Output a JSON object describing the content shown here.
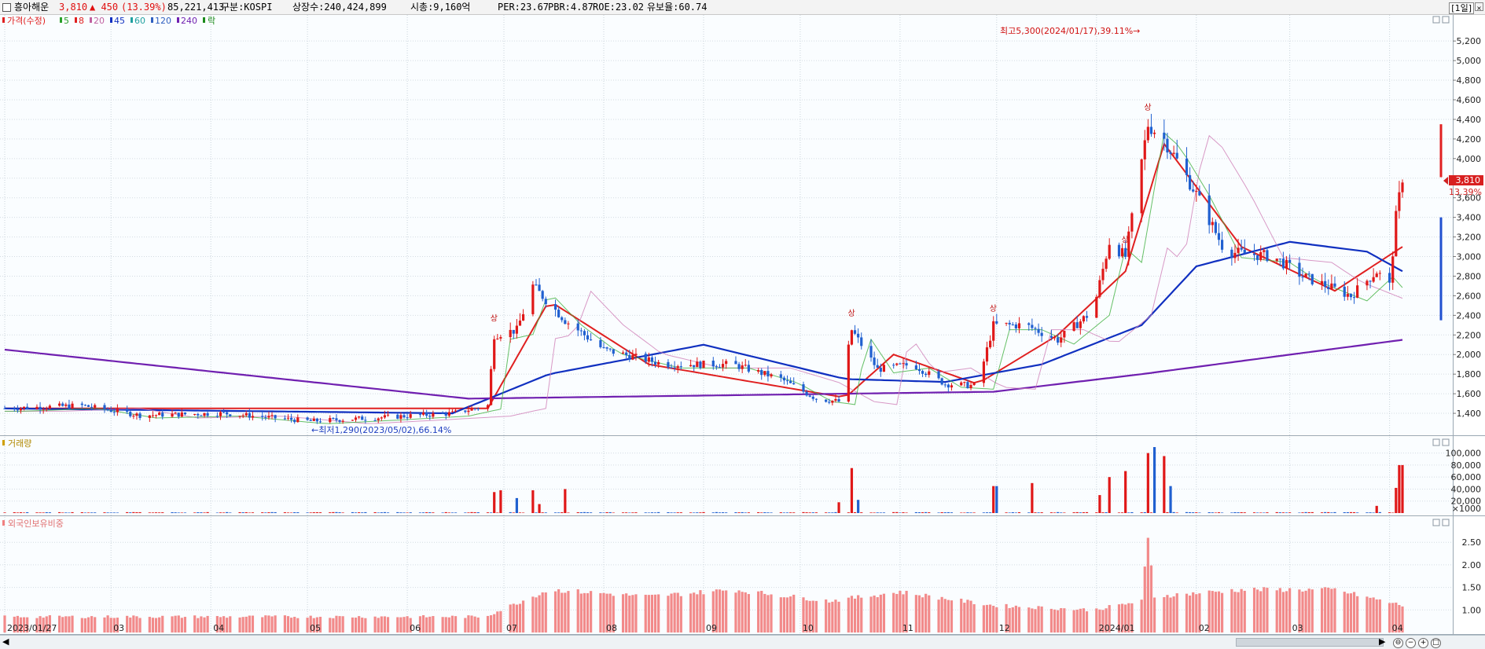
{
  "header": {
    "stock_name": "흥아해운",
    "price": "3,810",
    "change": "▲ 450",
    "change_pct": "(13.39%)",
    "volume": "85,221,413",
    "market": "구분:KOSPI",
    "shares": "상장수:240,424,899",
    "market_cap": "시총:9,160억",
    "per": "PER:23.67",
    "pbr": "PBR:4.87",
    "roe": "ROE:23.02",
    "float_ratio": "유보율:60.74",
    "period": "[1일]"
  },
  "legend": {
    "price_label": "가격(수정)",
    "ma_items": [
      {
        "label": "5",
        "color": "#2aa02a"
      },
      {
        "label": "8",
        "color": "#e02020"
      },
      {
        "label": "20",
        "color": "#c060a0"
      },
      {
        "label": "45",
        "color": "#1030c0"
      },
      {
        "label": "60",
        "color": "#20a0a0"
      },
      {
        "label": "120",
        "color": "#3060c0"
      },
      {
        "label": "240",
        "color": "#7020b0"
      }
    ],
    "limit_label": "락",
    "volume_label": "거래량",
    "foreign_label": "외국인보유비중"
  },
  "chart_data": [
    {
      "type": "candlestick",
      "title": "",
      "x_tick_labels": [
        "2023/01/27",
        "03",
        "04",
        "05",
        "06",
        "07",
        "08",
        "09",
        "10",
        "11",
        "12",
        "2024/01",
        "02",
        "03",
        "04"
      ],
      "y_tick_labels": [
        "1,400",
        "1,600",
        "1,800",
        "2,000",
        "2,200",
        "2,400",
        "2,600",
        "2,800",
        "3,000",
        "3,200",
        "3,400",
        "3,600",
        "3,800",
        "4,000",
        "4,200",
        "4,400",
        "4,600",
        "4,800",
        "5,000",
        "5,200"
      ],
      "ylim": [
        1200,
        5450
      ],
      "last_price_tag": "3,810",
      "last_pct_tag": "13.39%",
      "annotations": {
        "high": "최고5,300(2024/01/17),39.11%→",
        "low": "←최저1,290(2023/05/02),66.14%",
        "upper_limit_marker": "상"
      },
      "price_path": [
        [
          "2023-01-27",
          1450
        ],
        [
          "2023-02-20",
          1480
        ],
        [
          "2023-03-10",
          1380
        ],
        [
          "2023-04-05",
          1400
        ],
        [
          "2023-05-02",
          1320
        ],
        [
          "2023-05-25",
          1360
        ],
        [
          "2023-06-15",
          1400
        ],
        [
          "2023-06-26",
          1480
        ],
        [
          "2023-06-28",
          2200
        ],
        [
          "2023-07-05",
          2250
        ],
        [
          "2023-07-10",
          2700
        ],
        [
          "2023-07-20",
          2350
        ],
        [
          "2023-08-01",
          2050
        ],
        [
          "2023-08-20",
          1900
        ],
        [
          "2023-09-10",
          1900
        ],
        [
          "2023-09-25",
          1750
        ],
        [
          "2023-10-06",
          1550
        ],
        [
          "2023-10-13",
          1520
        ],
        [
          "2023-10-17",
          2250
        ],
        [
          "2023-10-25",
          1850
        ],
        [
          "2023-11-05",
          1900
        ],
        [
          "2023-11-15",
          1700
        ],
        [
          "2023-11-25",
          1680
        ],
        [
          "2023-11-30",
          2300
        ],
        [
          "2023-12-10",
          2300
        ],
        [
          "2023-12-20",
          2150
        ],
        [
          "2023-12-31",
          2450
        ],
        [
          "2024-01-05",
          3150
        ],
        [
          "2024-01-10",
          3000
        ],
        [
          "2024-01-17",
          4350
        ],
        [
          "2024-01-22",
          4200
        ],
        [
          "2024-01-31",
          3700
        ],
        [
          "2024-02-10",
          3050
        ],
        [
          "2024-02-25",
          3000
        ],
        [
          "2024-03-05",
          2800
        ],
        [
          "2024-03-20",
          2600
        ],
        [
          "2024-03-28",
          2850
        ],
        [
          "2024-04-01",
          2700
        ],
        [
          "2024-04-03",
          3400
        ],
        [
          "2024-04-05",
          3810
        ]
      ],
      "moving_averages": {
        "8": [
          [
            "2023-01-27",
            1450
          ],
          [
            "2023-06-26",
            1450
          ],
          [
            "2023-07-15",
            2550
          ],
          [
            "2023-08-15",
            1900
          ],
          [
            "2023-10-15",
            1560
          ],
          [
            "2023-10-30",
            2000
          ],
          [
            "2023-11-25",
            1700
          ],
          [
            "2023-12-20",
            2200
          ],
          [
            "2024-01-10",
            2850
          ],
          [
            "2024-01-22",
            4150
          ],
          [
            "2024-02-15",
            3100
          ],
          [
            "2024-03-15",
            2650
          ],
          [
            "2024-04-05",
            3100
          ]
        ],
        "45": [
          [
            "2023-01-27",
            1450
          ],
          [
            "2023-06-15",
            1400
          ],
          [
            "2023-07-15",
            1800
          ],
          [
            "2023-09-01",
            2100
          ],
          [
            "2023-10-15",
            1750
          ],
          [
            "2023-11-15",
            1720
          ],
          [
            "2023-12-15",
            1900
          ],
          [
            "2024-01-15",
            2300
          ],
          [
            "2024-02-01",
            2900
          ],
          [
            "2024-03-01",
            3150
          ],
          [
            "2024-03-25",
            3050
          ],
          [
            "2024-04-05",
            2850
          ]
        ],
        "240": [
          [
            "2023-01-27",
            2050
          ],
          [
            "2023-06-20",
            1550
          ],
          [
            "2023-11-30",
            1620
          ],
          [
            "2024-01-15",
            1800
          ],
          [
            "2024-04-05",
            2150
          ]
        ]
      }
    },
    {
      "type": "bar",
      "title": "",
      "y_tick_labels": [
        "100,000",
        "80,000",
        "60,000",
        "40,000",
        "20,000"
      ],
      "y_unit_label": "×1000",
      "ylim": [
        0,
        110000
      ],
      "spikes": [
        [
          "2023-06-28",
          35000,
          "up"
        ],
        [
          "2023-06-30",
          38000,
          "up"
        ],
        [
          "2023-07-05",
          25000,
          "down"
        ],
        [
          "2023-07-10",
          38000,
          "up"
        ],
        [
          "2023-07-12",
          15000,
          "up"
        ],
        [
          "2023-07-20",
          40000,
          "up"
        ],
        [
          "2023-10-13",
          18000,
          "up"
        ],
        [
          "2023-10-17",
          75000,
          "up"
        ],
        [
          "2023-10-19",
          22000,
          "down"
        ],
        [
          "2023-11-30",
          45000,
          "up"
        ],
        [
          "2023-12-01",
          45000,
          "down"
        ],
        [
          "2023-12-10",
          48000,
          "up"
        ],
        [
          "2023-12-12",
          50000,
          "up"
        ],
        [
          "2024-01-02",
          30000,
          "up"
        ],
        [
          "2024-01-05",
          60000,
          "up"
        ],
        [
          "2024-01-10",
          70000,
          "up"
        ],
        [
          "2024-01-17",
          100000,
          "up"
        ],
        [
          "2024-01-19",
          110000,
          "down"
        ],
        [
          "2024-01-22",
          95000,
          "up"
        ],
        [
          "2024-01-24",
          45000,
          "down"
        ],
        [
          "2024-03-28",
          12000,
          "up"
        ],
        [
          "2024-04-03",
          42000,
          "up"
        ],
        [
          "2024-04-04",
          80000,
          "up"
        ],
        [
          "2024-04-05",
          80000,
          "up"
        ]
      ]
    },
    {
      "type": "bar",
      "title": "",
      "y_tick_labels": [
        "2.50",
        "2.00",
        "1.50",
        "1.00"
      ],
      "ylim": [
        0.5,
        2.8
      ],
      "profile": [
        [
          "2023-01-27",
          0.85
        ],
        [
          "2023-06-25",
          0.85
        ],
        [
          "2023-07-15",
          1.45
        ],
        [
          "2023-08-15",
          1.3
        ],
        [
          "2023-09-10",
          1.45
        ],
        [
          "2023-10-10",
          1.2
        ],
        [
          "2023-11-01",
          1.4
        ],
        [
          "2023-11-30",
          1.1
        ],
        [
          "2023-12-31",
          1.0
        ],
        [
          "2024-01-15",
          1.2
        ],
        [
          "2024-01-17",
          2.6
        ],
        [
          "2024-01-19",
          1.3
        ],
        [
          "2024-02-15",
          1.45
        ],
        [
          "2024-03-15",
          1.45
        ],
        [
          "2024-04-05",
          1.1
        ]
      ]
    }
  ]
}
